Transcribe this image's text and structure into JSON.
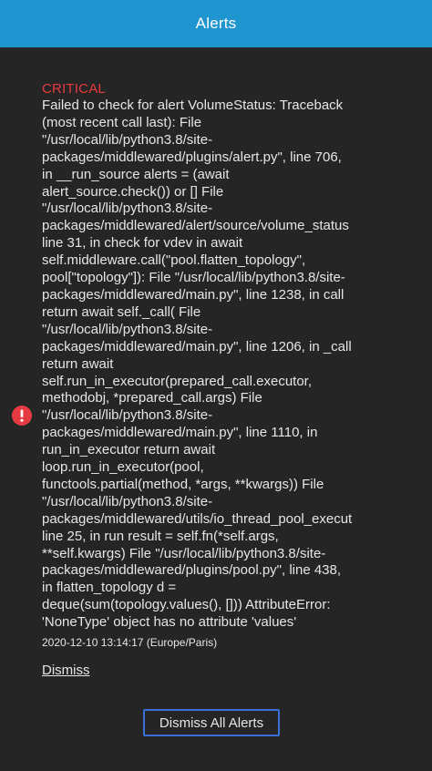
{
  "header": {
    "title": "Alerts"
  },
  "alert": {
    "level": "CRITICAL",
    "icon": "alert-circle-icon",
    "level_color": "#e53a40",
    "message": "Failed to check for alert VolumeStatus: Traceback\n(most recent call last): File\n\"/usr/local/lib/python3.8/site-\npackages/middlewared/plugins/alert.py\", line 706,\nin __run_source alerts = (await\nalert_source.check()) or [] File\n\"/usr/local/lib/python3.8/site-\npackages/middlewared/alert/source/volume_status\nline 31, in check for vdev in await\nself.middleware.call(\"pool.flatten_topology\",\npool[\"topology\"]): File \"/usr/local/lib/python3.8/site-\npackages/middlewared/main.py\", line 1238, in call\nreturn await self._call( File\n\"/usr/local/lib/python3.8/site-\npackages/middlewared/main.py\", line 1206, in _call\nreturn await\nself.run_in_executor(prepared_call.executor,\nmethodobj, *prepared_call.args) File\n\"/usr/local/lib/python3.8/site-\npackages/middlewared/main.py\", line 1110, in\nrun_in_executor return await\nloop.run_in_executor(pool,\nfunctools.partial(method, *args, **kwargs)) File\n\"/usr/local/lib/python3.8/site-\npackages/middlewared/utils/io_thread_pool_execut\nline 25, in run result = self.fn(*self.args,\n**self.kwargs) File \"/usr/local/lib/python3.8/site-\npackages/middlewared/plugins/pool.py\", line 438,\nin flatten_topology d =\ndeque(sum(topology.values(), [])) AttributeError:\n'NoneType' object has no attribute 'values'",
    "timestamp": "2020-12-10 13:14:17 (Europe/Paris)",
    "dismiss_label": "Dismiss"
  },
  "footer": {
    "dismiss_all_label": "Dismiss All Alerts"
  },
  "colors": {
    "header_bg": "#1f95d0",
    "panel_bg": "#252525",
    "button_border": "#3a6fd8"
  }
}
